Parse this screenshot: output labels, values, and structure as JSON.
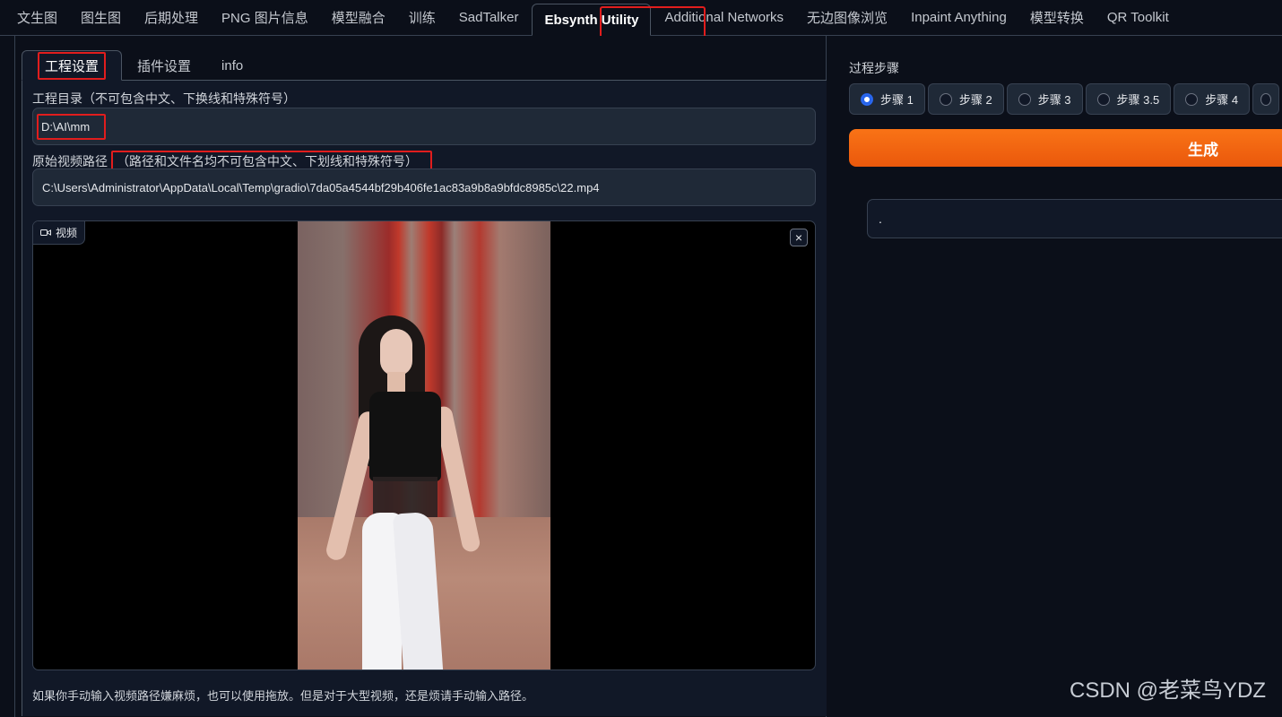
{
  "top_tabs": [
    {
      "label": "文生图"
    },
    {
      "label": "图生图"
    },
    {
      "label": "后期处理"
    },
    {
      "label": "PNG 图片信息"
    },
    {
      "label": "模型融合"
    },
    {
      "label": "训练"
    },
    {
      "label": "SadTalker"
    },
    {
      "label": "Ebsynth Utility",
      "active": true
    },
    {
      "label": "Additional Networks"
    },
    {
      "label": "无边图像浏览"
    },
    {
      "label": "Inpaint Anything"
    },
    {
      "label": "模型转换"
    },
    {
      "label": "QR Toolkit"
    }
  ],
  "sub_tabs": [
    {
      "label": "工程设置",
      "active": true
    },
    {
      "label": "插件设置"
    },
    {
      "label": "info"
    }
  ],
  "project": {
    "dir_label": "工程目录（不可包含中文、下换线和特殊符号）",
    "dir_value": "D:\\AI\\mm",
    "video_label": "原始视频路径",
    "video_label_note": "（路径和文件名均不可包含中文、下划线和特殊符号）",
    "video_value": "C:\\Users\\Administrator\\AppData\\Local\\Temp\\gradio\\7da05a4544bf29b406fe1ac83a9b8a9bfdc8985c\\22.mp4"
  },
  "video_panel": {
    "tag_label": "视频",
    "close_glyph": "×"
  },
  "hint_text": "如果你手动输入视频路径嫌麻烦，也可以使用拖放。但是对于大型视频，还是烦请手动输入路径。",
  "steps": {
    "label": "过程步骤",
    "options": [
      {
        "label": "步骤 1",
        "selected": true
      },
      {
        "label": "步骤 2"
      },
      {
        "label": "步骤 3"
      },
      {
        "label": "步骤 3.5"
      },
      {
        "label": "步骤 4"
      }
    ]
  },
  "generate_label": "生成",
  "output_text": ".",
  "watermark": "CSDN @老菜鸟YDZ",
  "colors": {
    "accent_orange": "#f97316",
    "highlight_red": "#e11d1d",
    "radio_blue": "#2563eb"
  }
}
